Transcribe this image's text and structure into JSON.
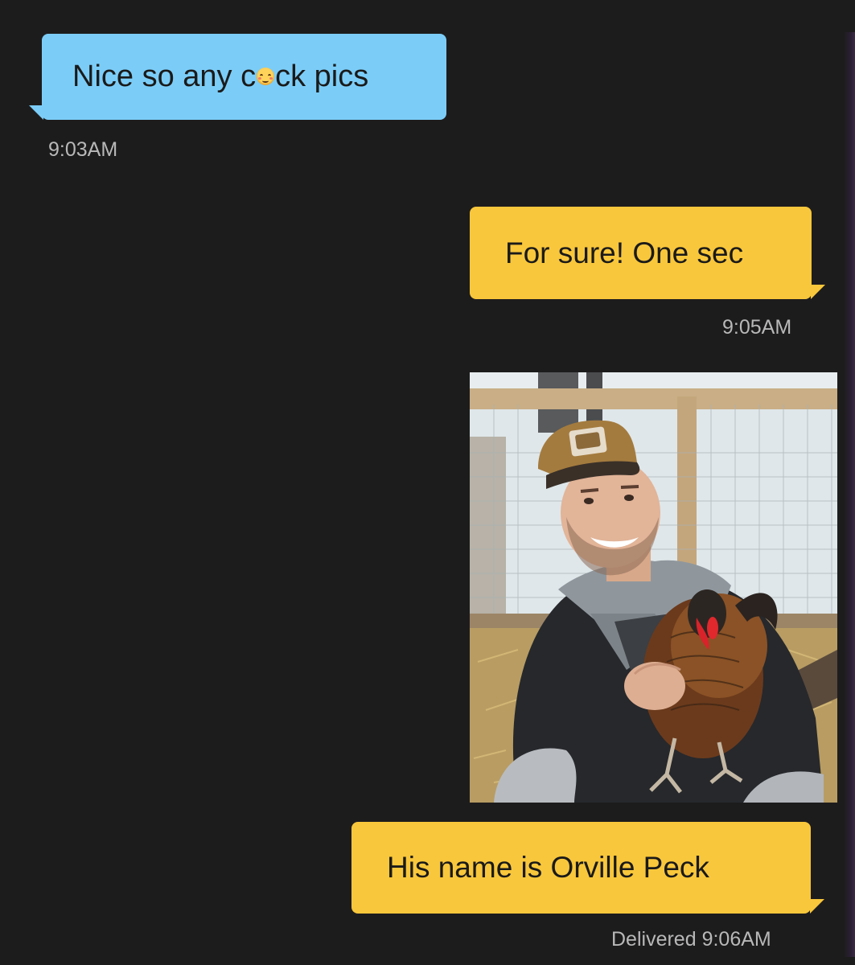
{
  "conversation": {
    "messages": [
      {
        "direction": "incoming",
        "text_before": "Nice so any c",
        "emoji": "smiling-face-with-hearts-emoji",
        "text_after": "ck pics",
        "time": "9:03AM"
      },
      {
        "direction": "outgoing",
        "text": "For sure! One sec",
        "time": "9:05AM"
      },
      {
        "direction": "outgoing",
        "type": "photo",
        "photo_description_icon": "photo-man-holding-chicken"
      },
      {
        "direction": "outgoing",
        "text": "His name is Orville Peck",
        "status": "Delivered",
        "time": "9:06AM"
      }
    ]
  },
  "colors": {
    "background": "#1d1c1d",
    "incoming_bubble": "#7bcdf8",
    "outgoing_bubble": "#f9c73b",
    "timestamp": "#b8b8b8"
  }
}
